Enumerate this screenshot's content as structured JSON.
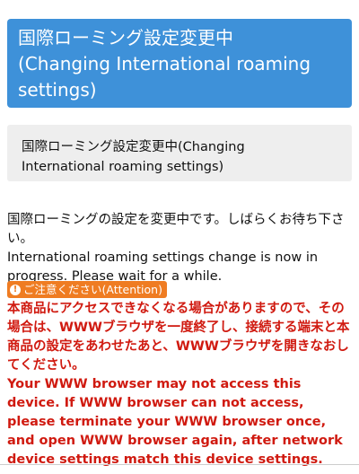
{
  "header": {
    "title_line1": "国際ローミング設定変更中",
    "title_line2": "(Changing International roaming",
    "title_line3": "settings)",
    "color": "#3e91d9"
  },
  "subheader": {
    "line1": "国際ローミング設定変更中(Changing",
    "line2": "International roaming settings)"
  },
  "message": {
    "japanese": "国際ローミングの設定を変更中です。しばらくお待ち下さい。",
    "english": "International roaming settings change is now in progress. Please wait for a while."
  },
  "attention": {
    "icon": "warning-icon",
    "label": "ご注意ください(Attention)",
    "color": "#ef7c22"
  },
  "warning": {
    "japanese": "本商品にアクセスできなくなる場合がありますので、その場合は、WWWブラウザを一度終了し、接続する端末と本商品の設定をあわせたあと、WWWブラウザを開きなおしてください。",
    "english": "Your WWW browser may not access this device. If WWW browser can not access, please terminate your WWW browser once, and open WWW browser again, after network device settings match this device settings.",
    "color": "#d01a10"
  }
}
